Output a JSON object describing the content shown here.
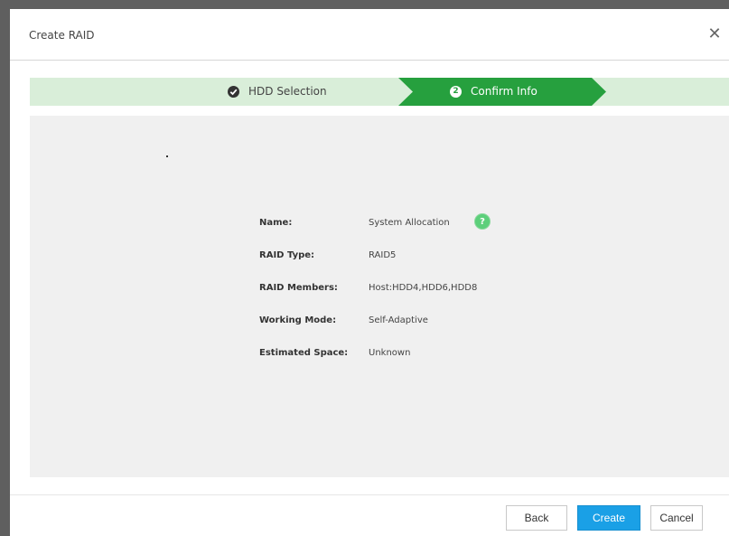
{
  "dialog": {
    "title": "Create RAID",
    "close_icon": "close-icon"
  },
  "steps": [
    {
      "label": "HDD Selection",
      "state": "completed",
      "icon": "check-circle-icon"
    },
    {
      "label": "Confirm Info",
      "state": "active",
      "number": "2"
    }
  ],
  "info": {
    "name_label": "Name:",
    "name_value": "System Allocation",
    "help_icon": "?",
    "raid_type_label": "RAID Type:",
    "raid_type_value": "RAID5",
    "members_label": "RAID Members:",
    "members_value": "Host:HDD4,HDD6,HDD8",
    "mode_label": "Working Mode:",
    "mode_value": "Self-Adaptive",
    "space_label": "Estimated Space:",
    "space_value": "Unknown"
  },
  "buttons": {
    "back": "Back",
    "create": "Create",
    "cancel": "Cancel"
  },
  "colors": {
    "accent_green": "#26a03e",
    "stepper_bg": "#d9eed9",
    "primary_button": "#1aa0e6",
    "content_bg": "#f0f0f0"
  }
}
